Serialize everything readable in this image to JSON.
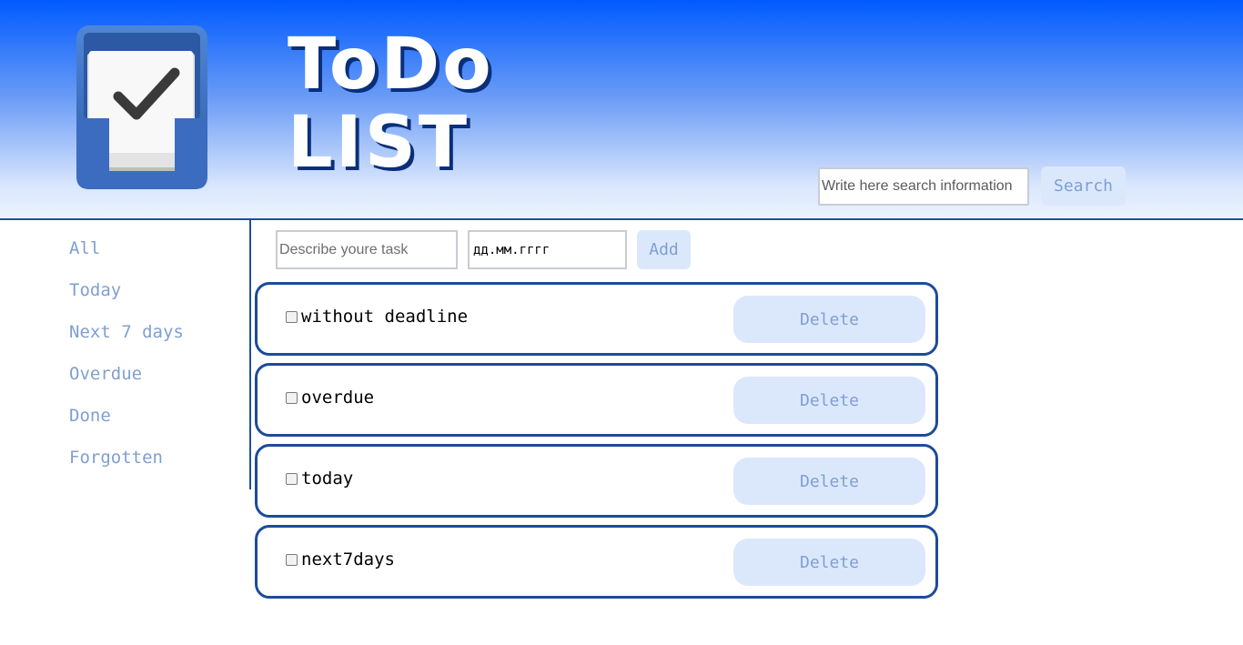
{
  "header": {
    "title_line1": "ToDo",
    "title_line2": "LIST",
    "search_placeholder": "Write here search information",
    "search_label": "Search"
  },
  "sidebar": {
    "items": [
      {
        "label": "All"
      },
      {
        "label": "Today"
      },
      {
        "label": "Next 7 days"
      },
      {
        "label": "Overdue"
      },
      {
        "label": "Done"
      },
      {
        "label": "Forgotten"
      }
    ]
  },
  "form": {
    "task_placeholder": "Describe youre task",
    "date_placeholder": "дд.мм.гггг",
    "add_label": "Add"
  },
  "tasks": [
    {
      "label": "without deadline",
      "delete_label": "Delete"
    },
    {
      "label": "overdue",
      "delete_label": "Delete"
    },
    {
      "label": "today",
      "delete_label": "Delete"
    },
    {
      "label": "next7days",
      "delete_label": "Delete"
    }
  ],
  "colors": {
    "accent": "#1d4f9c",
    "button_bg": "#dbe8fc",
    "button_text": "#7f9fd2"
  }
}
